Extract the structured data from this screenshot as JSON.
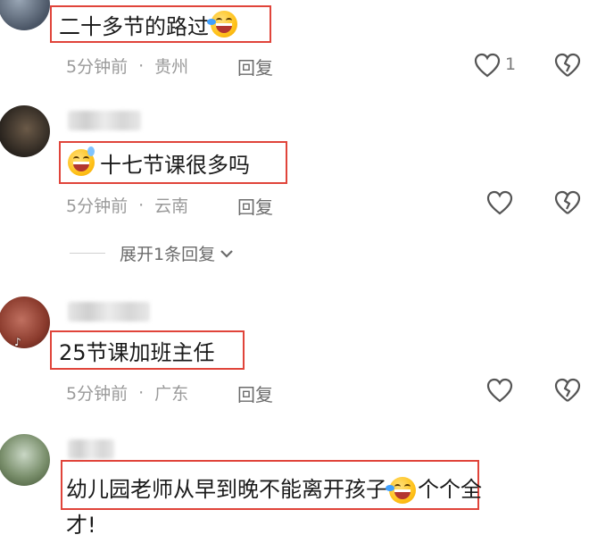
{
  "comments": [
    {
      "text": "二十多节的路过",
      "emoji": "laugh-cry-emoji",
      "time": "5分钟前",
      "location": "贵州",
      "reply_label": "回复",
      "like_count": "1"
    },
    {
      "text": "十七节课很多吗",
      "emoji": "grin-sweat-emoji",
      "time": "5分钟前",
      "location": "云南",
      "reply_label": "回复",
      "like_count": ""
    },
    {
      "text": "25节课加班主任",
      "time": "5分钟前",
      "location": "广东",
      "reply_label": "回复",
      "like_count": ""
    },
    {
      "text_part1": "幼儿园老师从早到晚不能离开孩子",
      "text_part2": "个个全",
      "text_part3": "才!",
      "emoji": "laugh-cry-emoji"
    }
  ],
  "expand_replies_label": "展开1条回复",
  "meta_separator": "·",
  "colors": {
    "highlight_box": "#e0443a",
    "meta_text": "#9a9a9a"
  },
  "icons": [
    "heart-icon",
    "dislike-broken-heart-icon",
    "chevron-down-icon"
  ]
}
